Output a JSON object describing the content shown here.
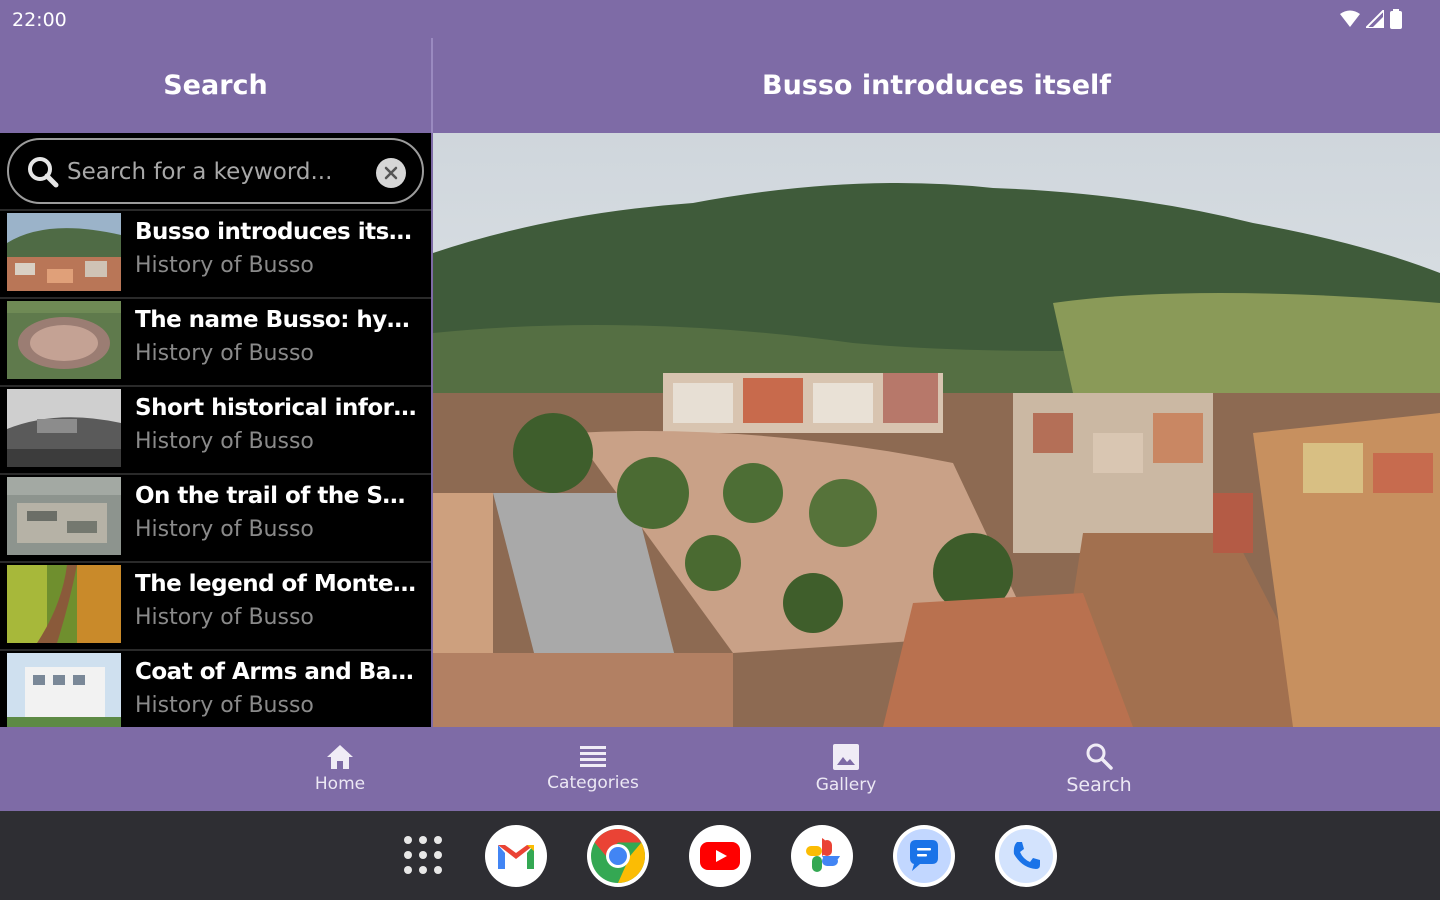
{
  "status_bar": {
    "time": "22:00"
  },
  "left_header": {
    "title": "Search"
  },
  "right_header": {
    "title": "Busso introduces itself"
  },
  "search": {
    "placeholder": "Search for a keyword..."
  },
  "results": [
    {
      "title": "Busso introduces itself",
      "subtitle": "History of Busso"
    },
    {
      "title": "The name Busso: hypot...",
      "subtitle": "History of Busso"
    },
    {
      "title": "Short historical informat...",
      "subtitle": "History of Busso"
    },
    {
      "title": "On the trail of the Samni...",
      "subtitle": "History of Busso"
    },
    {
      "title": "The legend of Monte Vai...",
      "subtitle": "History of Busso"
    },
    {
      "title": "Coat of Arms and Banner",
      "subtitle": "History of Busso"
    }
  ],
  "bottom_nav": {
    "home": "Home",
    "categories": "Categories",
    "gallery": "Gallery",
    "search": "Search"
  },
  "taskbar": {
    "apps": [
      "app-drawer-icon",
      "gmail-icon",
      "chrome-icon",
      "youtube-icon",
      "photos-icon",
      "messages-icon",
      "phone-icon"
    ]
  },
  "colors": {
    "primary": "#7e6ba6",
    "list_bg": "#000000",
    "taskbar": "#2e2e33"
  }
}
